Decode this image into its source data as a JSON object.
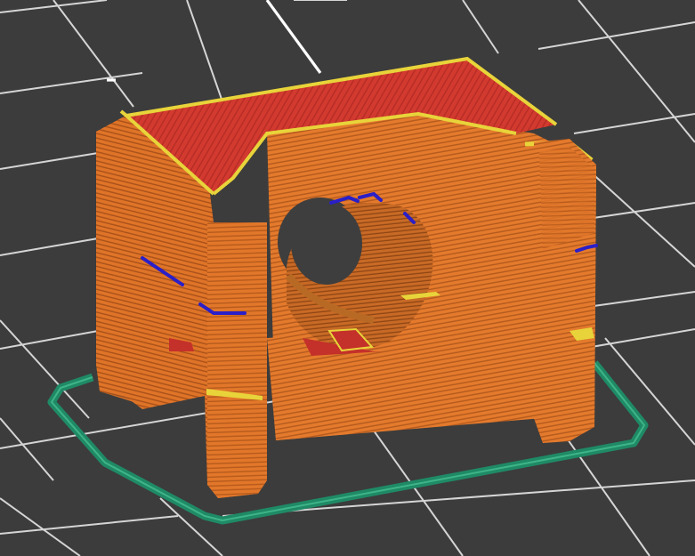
{
  "viewport": {
    "background": "#3c3c3c",
    "grid_color": "#d8d8d8",
    "grid_major_color": "#ffffff"
  },
  "legend_colors": {
    "perimeter": "#e2772a",
    "perimeter_dark": "#b85818",
    "top_solid_infill": "#d23a2e",
    "solid_infill": "#c4302a",
    "ironing_edge": "#e8d43a",
    "overhang_perimeter": "#2a1fc8",
    "skirt": "#1f8a66",
    "skirt_light": "#2ea37a"
  },
  "model": {
    "name_icon": "sliced-part-preview"
  }
}
